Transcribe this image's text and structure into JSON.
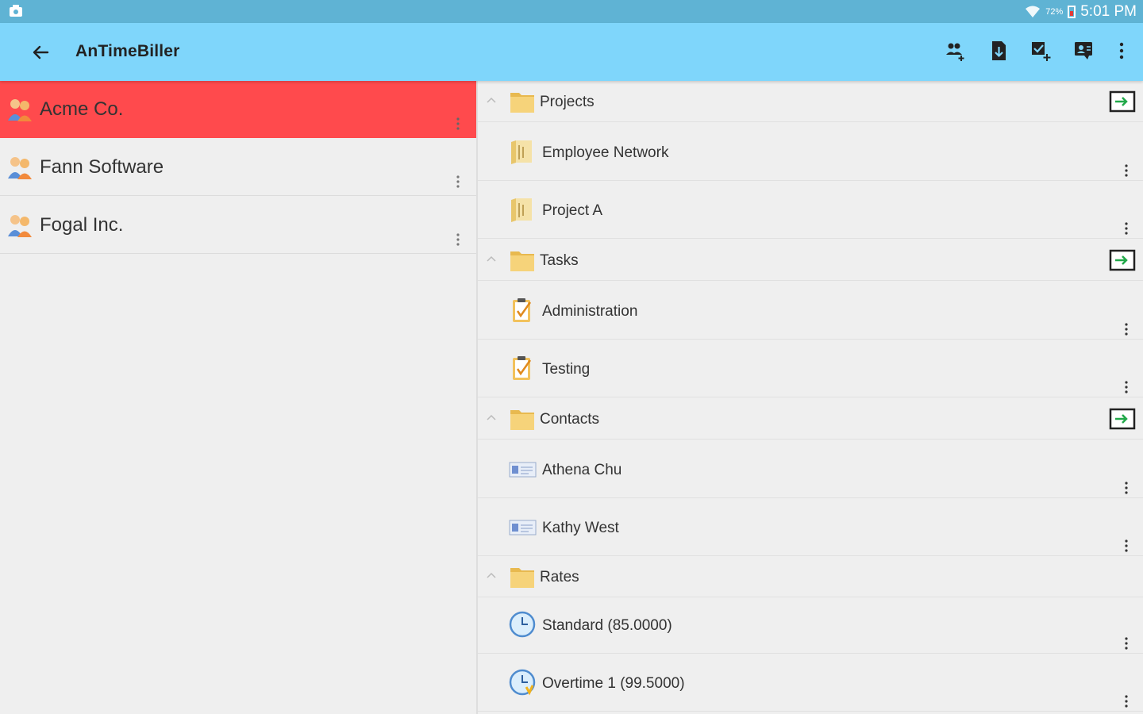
{
  "status_bar": {
    "time": "5:01 PM",
    "battery_percent": "72%"
  },
  "app_bar": {
    "title": "AnTimeBiller",
    "icons": [
      "back-arrow-icon",
      "add-client-icon",
      "download-icon",
      "add-task-icon",
      "add-contact-icon",
      "overflow-menu-icon"
    ]
  },
  "clients": [
    {
      "name": "Acme Co.",
      "selected": true
    },
    {
      "name": "Fann Software",
      "selected": false
    },
    {
      "name": "Fogal Inc.",
      "selected": false
    }
  ],
  "sections": {
    "projects": {
      "label": "Projects",
      "items": [
        "Employee Network",
        "Project A"
      ]
    },
    "tasks": {
      "label": "Tasks",
      "items": [
        "Administration",
        "Testing"
      ]
    },
    "contacts": {
      "label": "Contacts",
      "items": [
        "Athena Chu",
        "Kathy West"
      ]
    },
    "rates": {
      "label": "Rates",
      "items": [
        "Standard (85.0000)",
        "Overtime 1 (99.5000)"
      ]
    }
  },
  "colors": {
    "status_bar": "#5fb3d4",
    "app_bar": "#7fd6fb",
    "selected_row": "#ff4a4d",
    "background": "#efefef"
  }
}
